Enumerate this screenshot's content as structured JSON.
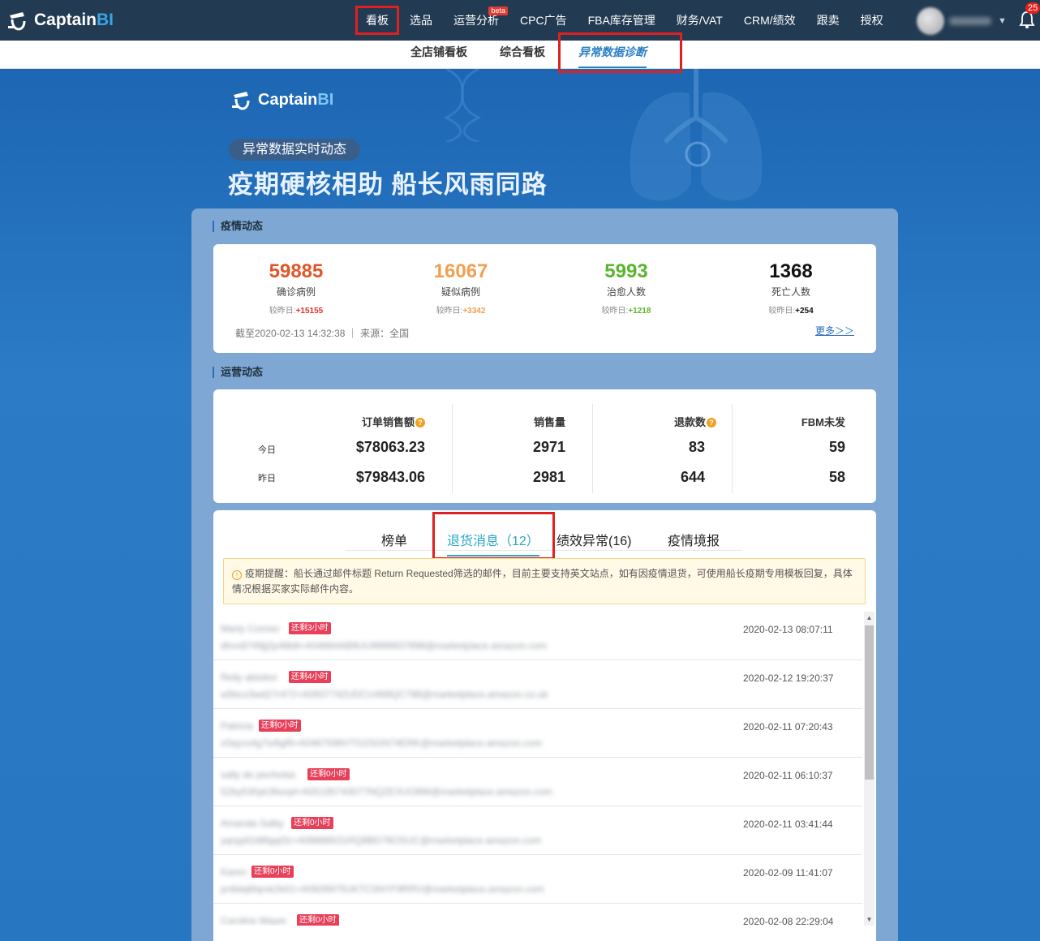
{
  "header": {
    "brand": "Captain",
    "brand_accent": "BI",
    "nav": [
      {
        "label": "看板",
        "active": true
      },
      {
        "label": "选品"
      },
      {
        "label": "运营分析",
        "badge": "beta"
      },
      {
        "label": "CPC广告"
      },
      {
        "label": "FBA库存管理"
      },
      {
        "label": "财务/VAT"
      },
      {
        "label": "CRM/绩效"
      },
      {
        "label": "跟卖"
      },
      {
        "label": "授权"
      }
    ],
    "notifications": "25"
  },
  "subnav": {
    "items": [
      "全店铺看板",
      "综合看板",
      "异常数据诊断"
    ],
    "active_index": 2
  },
  "banner": {
    "brand": "Captain",
    "brand_accent": "BI",
    "tag": "异常数据实时动态",
    "slogan": "疫期硬核相助 船长风雨同路"
  },
  "epidemic": {
    "title": "疫情动态",
    "stats": [
      {
        "value": "59885",
        "label": "确诊病例",
        "delta_label": "较昨日:",
        "delta": "+15155",
        "color": "#e0562b",
        "delta_color": "#e0302b"
      },
      {
        "value": "16067",
        "label": "疑似病例",
        "delta_label": "较昨日:",
        "delta": "+3342",
        "color": "#f0a050",
        "delta_color": "#f0a050"
      },
      {
        "value": "5993",
        "label": "治愈人数",
        "delta_label": "较昨日:",
        "delta": "+1218",
        "color": "#5ab52c",
        "delta_color": "#5ab52c"
      },
      {
        "value": "1368",
        "label": "死亡人数",
        "delta_label": "较昨日:",
        "delta": "+254",
        "color": "#111111",
        "delta_color": "#111111"
      }
    ],
    "footer": "截至2020-02-13 14:32:38 ｜ 来源：全国",
    "more": "更多＞＞"
  },
  "operations": {
    "title": "运营动态",
    "row_labels": [
      "今日",
      "昨日"
    ],
    "columns": [
      {
        "header": "订单销售额",
        "help": true,
        "today": "$78063.23",
        "yesterday": "$79843.06"
      },
      {
        "header": "销售量",
        "help": false,
        "today": "2971",
        "yesterday": "2981"
      },
      {
        "header": "退款数",
        "help": true,
        "today": "83",
        "yesterday": "644"
      },
      {
        "header": "FBM未发",
        "help": false,
        "today": "59",
        "yesterday": "58"
      }
    ]
  },
  "messages": {
    "tabs": [
      "榜单",
      "退货消息（12）",
      "绩效异常(16)",
      "疫情境报"
    ],
    "active_tab": 1,
    "notice": "疫期提醒：船长通过邮件标题 Return Requested筛选的邮件，目前主要支持英文站点，如有因疫情退货，可使用船长疫期专用模板回复，具体情况根据买家实际邮件内容。",
    "rows": [
      {
        "name": "Marty Conner",
        "badge": "还剩3小时",
        "email": "dhvx8749jj2p48b8+A04664AB9UU9999937898@marketplace.amazon.com",
        "time": "2020-02-13 08:07:11"
      },
      {
        "name": "Reily abiobor",
        "badge": "还剩4小时",
        "email": "w5bcx3wd27r472+A0937742UDCU469QC798@marketplace.amazon.co.uk",
        "time": "2020-02-12 19:20:37"
      },
      {
        "name": "Patricia",
        "badge": "还剩0小时",
        "email": "v0ayvx4g7w9gf9+A0467596VTG2SGN74ERK@marketplace.amazon.com",
        "time": "2020-02-11 07:20:43"
      },
      {
        "name": "sally de pechotas",
        "badge": "还剩0小时",
        "email": "52by530yk36snpl+A05195743077NQZEXUO8W@marketplace.amazon.com",
        "time": "2020-02-11 06:10:37"
      },
      {
        "name": "Amanda Salby",
        "badge": "还剩0小时",
        "email": "yqnpj42d8fgqt3z+A08888531RQ8BD76OSUC@marketplace.amazon.com",
        "time": "2020-02-11 03:41:44"
      },
      {
        "name": "Karen",
        "badge": "还剩0小时",
        "email": "pn6dq6fqrsk2k51+A0926975UKTC5NYF9RRV@marketplace.amazon.com",
        "time": "2020-02-09 11:41:07"
      },
      {
        "name": "Caroline Mayer",
        "badge": "还剩0小时",
        "email": "",
        "time": "2020-02-08 22:29:04"
      }
    ]
  }
}
